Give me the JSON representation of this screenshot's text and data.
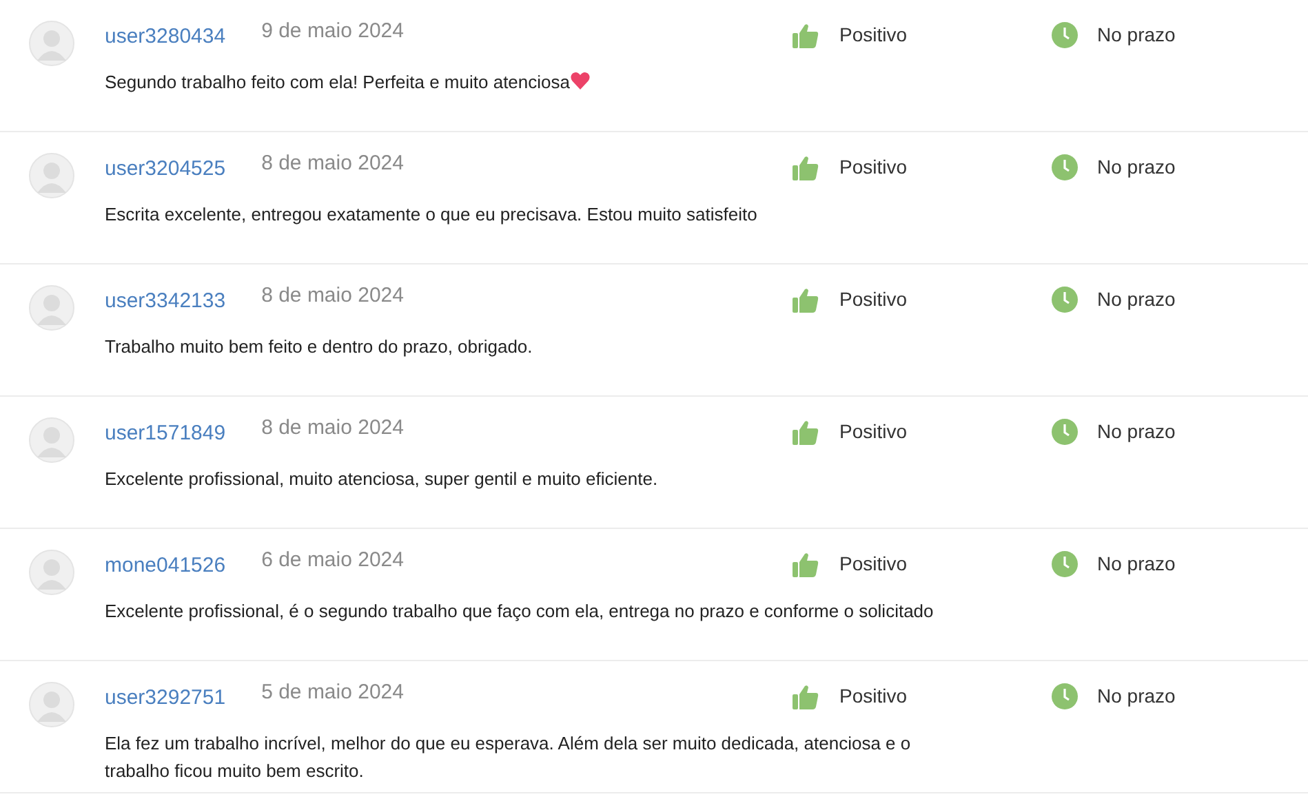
{
  "reviews": [
    {
      "user": "user3280434",
      "date": "9 de maio 2024",
      "rating": "Positivo",
      "timing": "No prazo",
      "comment": "Segundo trabalho feito com ela! Perfeita e muito atenciosa",
      "heart": true
    },
    {
      "user": "user3204525",
      "date": "8 de maio 2024",
      "rating": "Positivo",
      "timing": "No prazo",
      "comment": "Escrita excelente, entregou exatamente o que eu precisava. Estou muito satisfeito"
    },
    {
      "user": "user3342133",
      "date": "8 de maio 2024",
      "rating": "Positivo",
      "timing": "No prazo",
      "comment": "Trabalho muito bem feito e dentro do prazo, obrigado."
    },
    {
      "user": "user1571849",
      "date": "8 de maio 2024",
      "rating": "Positivo",
      "timing": "No prazo",
      "comment": "Excelente profissional, muito atenciosa, super gentil e muito eficiente."
    },
    {
      "user": "mone041526",
      "date": "6 de maio 2024",
      "rating": "Positivo",
      "timing": "No prazo",
      "comment": "Excelente profissional, é o segundo trabalho que faço com ela, entrega no prazo e conforme o solicitado"
    },
    {
      "user": "user3292751",
      "date": "5 de maio 2024",
      "rating": "Positivo",
      "timing": "No prazo",
      "comment": "Ela fez um trabalho incrível, melhor do que eu esperava. Além dela ser muito dedicada, atenciosa e o trabalho ficou muito bem escrito."
    }
  ]
}
